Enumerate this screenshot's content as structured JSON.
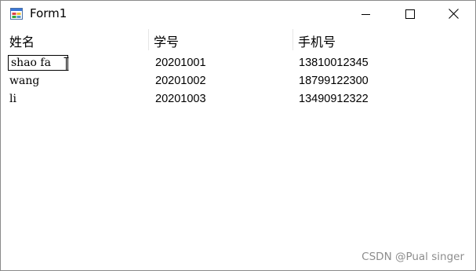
{
  "window": {
    "title": "Form1",
    "controls": {
      "minimize": "minimize",
      "maximize": "maximize",
      "close": "close"
    }
  },
  "listview": {
    "columns": [
      "姓名",
      "学号",
      "手机号"
    ],
    "rows": [
      {
        "name": "shao fa",
        "id": "20201001",
        "phone": "13810012345"
      },
      {
        "name": "wang",
        "id": "20201002",
        "phone": "18799122300"
      },
      {
        "name": "li",
        "id": "20201003",
        "phone": "13490912322"
      }
    ],
    "editing": {
      "value": "shao fa"
    }
  },
  "watermark": "CSDN @Pual singer",
  "icons": {
    "app": "form-app-icon",
    "minimize": "minimize-icon",
    "maximize": "maximize-icon",
    "close": "close-icon",
    "cursor": "text-cursor-icon"
  }
}
